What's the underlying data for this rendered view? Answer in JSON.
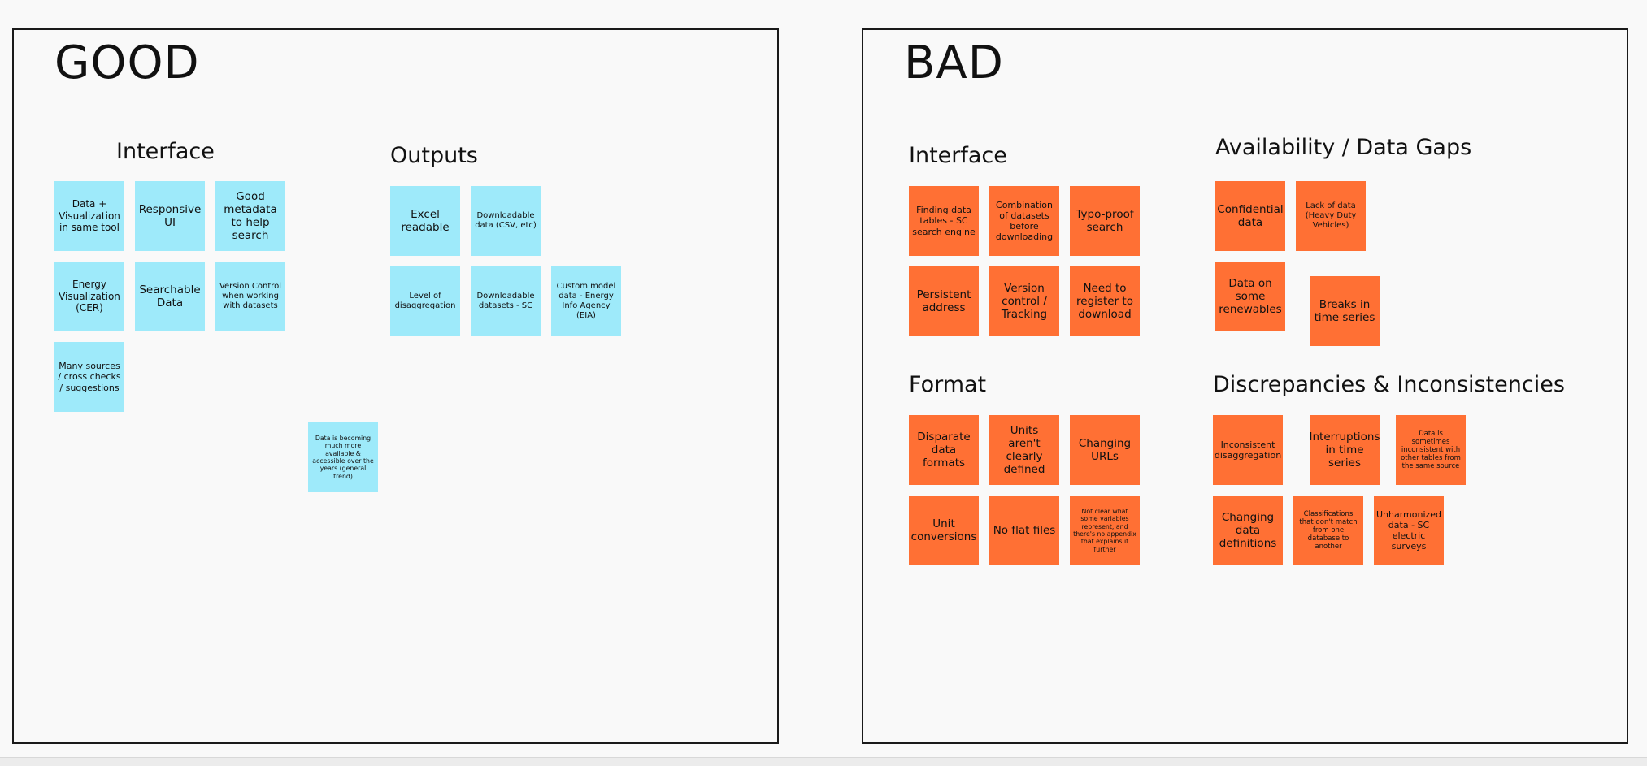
{
  "good": {
    "title": "GOOD",
    "sections": {
      "interface": "Interface",
      "outputs": "Outputs"
    },
    "notes": [
      "Data + Visualization in same tool",
      "Responsive UI",
      "Good metadata to help search",
      "Energy Visualization (CER)",
      "Searchable Data",
      "Version Control when working with datasets",
      "Many sources / cross checks / suggestions",
      "Excel readable",
      "Downloadable data (CSV, etc)",
      "Level of disaggregation",
      "Downloadable datasets - SC",
      "Custom model data - Energy Info Agency (EIA)",
      "Data is becoming much more available & accessible over the years (general trend)"
    ]
  },
  "bad": {
    "title": "BAD",
    "sections": {
      "interface": "Interface",
      "availability": "Availability / Data Gaps",
      "format": "Format",
      "discrepancies": "Discrepancies & Inconsistencies"
    },
    "notes": [
      "Finding data tables - SC search engine",
      "Combination of datasets before downloading",
      "Typo-proof search",
      "Persistent address",
      "Version control / Tracking",
      "Need to register to download",
      "Confidential data",
      "Lack of data (Heavy Duty Vehicles)",
      "Data on some renewables",
      "Breaks in time series",
      "Disparate data formats",
      "Units aren't clearly defined",
      "Changing URLs",
      "Unit conversions",
      "No flat files",
      "Not clear what some variables represent, and there's no appendix that explains it further",
      "Inconsistent disaggregation",
      "Interruptions in time series",
      "Data is sometimes inconsistent with other tables from the same source",
      "Changing data definitions",
      "Classifications that don't match from one database to another",
      "Unharmonized data - SC electric surveys"
    ]
  },
  "colors": {
    "good_note": "#9eeafa",
    "bad_note": "#ff7034",
    "background": "#f9f9f9",
    "frame_border": "#1a1a1a"
  }
}
